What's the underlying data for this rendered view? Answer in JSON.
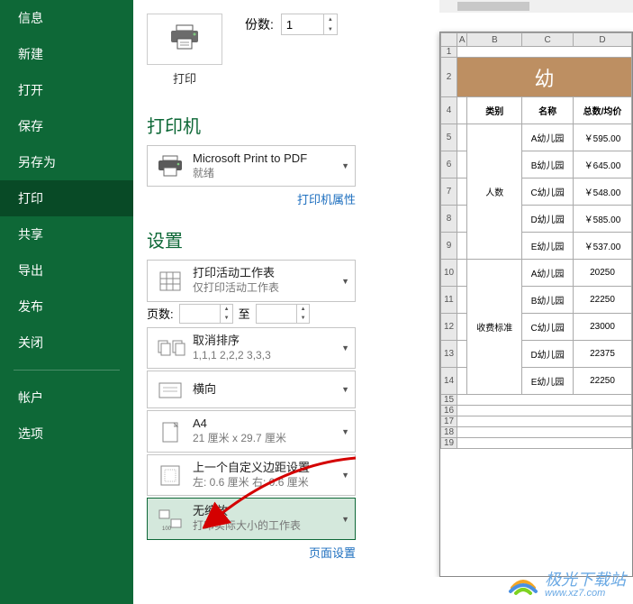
{
  "page_title": "打印",
  "sidebar": {
    "items": [
      {
        "label": "信息"
      },
      {
        "label": "新建"
      },
      {
        "label": "打开"
      },
      {
        "label": "保存"
      },
      {
        "label": "另存为"
      },
      {
        "label": "打印"
      },
      {
        "label": "共享"
      },
      {
        "label": "导出"
      },
      {
        "label": "发布"
      },
      {
        "label": "关闭"
      },
      {
        "label": "帐户"
      },
      {
        "label": "选项"
      }
    ]
  },
  "print_button": {
    "label": "打印"
  },
  "copies": {
    "label": "份数:",
    "value": "1"
  },
  "printer_section": {
    "title": "打印机",
    "name": "Microsoft Print to PDF",
    "status": "就绪",
    "properties_link": "打印机属性"
  },
  "settings_section": {
    "title": "设置",
    "active_sheets": {
      "title": "打印活动工作表",
      "sub": "仅打印活动工作表"
    },
    "pages": {
      "label": "页数:",
      "to": "至"
    },
    "collate": {
      "title": "取消排序",
      "sub": "1,1,1    2,2,2    3,3,3"
    },
    "orientation": {
      "title": "横向"
    },
    "paper": {
      "title": "A4",
      "sub": "21 厘米 x 29.7 厘米"
    },
    "margins": {
      "title": "上一个自定义边距设置",
      "sub": "左:  0.6 厘米    右:  0.6 厘米"
    },
    "scaling": {
      "title": "无缩放",
      "sub": "打印实际大小的工作表"
    },
    "page_setup_link": "页面设置"
  },
  "preview": {
    "title_fragment": "幼",
    "columns": [
      "A",
      "B",
      "C",
      "D"
    ],
    "row_numbers": [
      "1",
      "2",
      "4",
      "5",
      "6",
      "7",
      "8",
      "9",
      "10",
      "11",
      "12",
      "13",
      "14",
      "15",
      "16",
      "17",
      "18",
      "19"
    ],
    "headers": {
      "c1": "类别",
      "c2": "名称",
      "c3": "总数/均价"
    },
    "group1_label": "人数",
    "group2_label": "收费标准",
    "rows_group1": [
      {
        "name": "A幼儿园",
        "val": "￥595.00"
      },
      {
        "name": "B幼儿园",
        "val": "￥645.00"
      },
      {
        "name": "C幼儿园",
        "val": "￥548.00"
      },
      {
        "name": "D幼儿园",
        "val": "￥585.00"
      },
      {
        "name": "E幼儿园",
        "val": "￥537.00"
      }
    ],
    "rows_group2": [
      {
        "name": "A幼儿园",
        "val": "20250"
      },
      {
        "name": "B幼儿园",
        "val": "22250"
      },
      {
        "name": "C幼儿园",
        "val": "23000"
      },
      {
        "name": "D幼儿园",
        "val": "22375"
      },
      {
        "name": "E幼儿园",
        "val": "22250"
      }
    ]
  },
  "watermark": {
    "text": "极光下载站",
    "url": "www.xz7.com"
  }
}
